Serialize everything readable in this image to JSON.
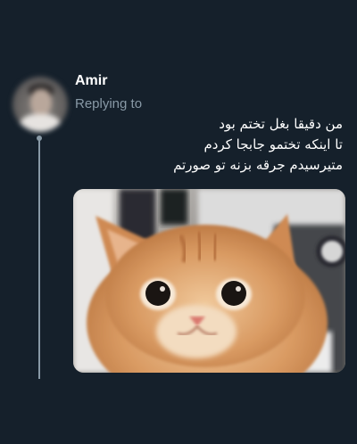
{
  "tweet": {
    "author": {
      "name": "Amir",
      "replying_label": "Replying to"
    },
    "text_lines": [
      "من دقیقا بغل تختم بود",
      "تا اینکه تختمو جابجا کردم",
      "متیرسیدم جرقه بزنه تو صورتم"
    ],
    "media": {
      "icon": "cat-photo-icon"
    }
  },
  "colors": {
    "background": "#15202b",
    "primary_text": "#ffffff",
    "secondary_text": "#8899a6",
    "thread_line": "#8899a6"
  }
}
